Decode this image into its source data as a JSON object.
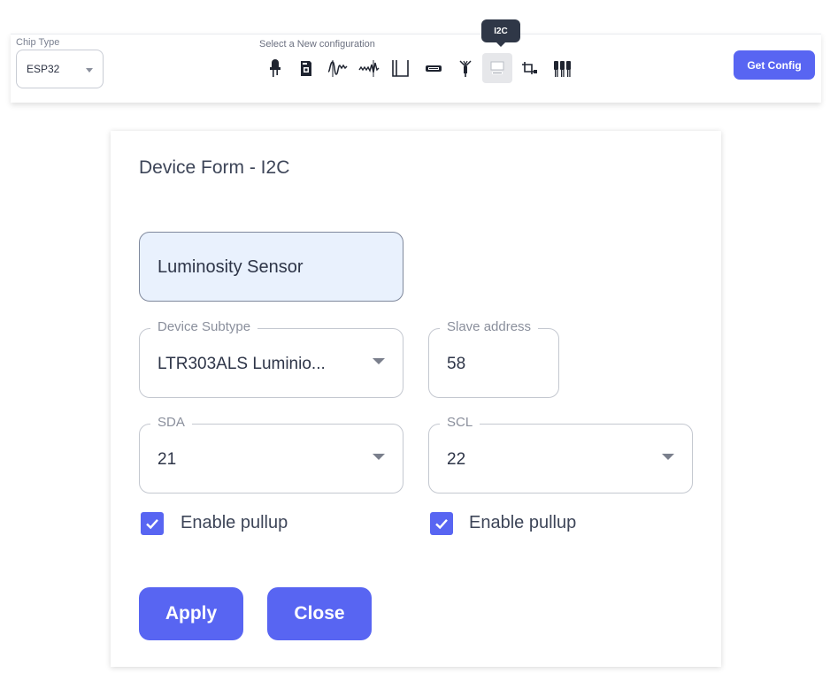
{
  "toolbar": {
    "chip_type_label": "Chip Type",
    "chip_type_value": "ESP32",
    "config_label": "Select a New configuration",
    "tooltip": "I2C",
    "get_config_label": "Get Config",
    "icons": [
      "led-icon",
      "relay-icon",
      "pwm-wave-icon",
      "analog-wave-icon",
      "digital-pulse-icon",
      "display-icon",
      "antenna-icon",
      "i2c-chip-icon",
      "connection-icon",
      "multi-pin-icon"
    ],
    "active_icon": "i2c-chip-icon"
  },
  "form": {
    "title": "Device Form - I2C",
    "device_name": "Luminosity Sensor",
    "device_subtype_label": "Device Subtype",
    "device_subtype_value": "LTR303ALS Luminio...",
    "slave_address_label": "Slave address",
    "slave_address_value": "58",
    "sda_label": "SDA",
    "sda_value": "21",
    "scl_label": "SCL",
    "scl_value": "22",
    "sda_pullup_label": "Enable pullup",
    "scl_pullup_label": "Enable pullup",
    "sda_pullup_checked": true,
    "scl_pullup_checked": true,
    "apply_label": "Apply",
    "close_label": "Close"
  },
  "colors": {
    "accent": "#5865f2",
    "name_field_bg": "#e9f1fd",
    "tooltip_bg": "#2f3747"
  }
}
